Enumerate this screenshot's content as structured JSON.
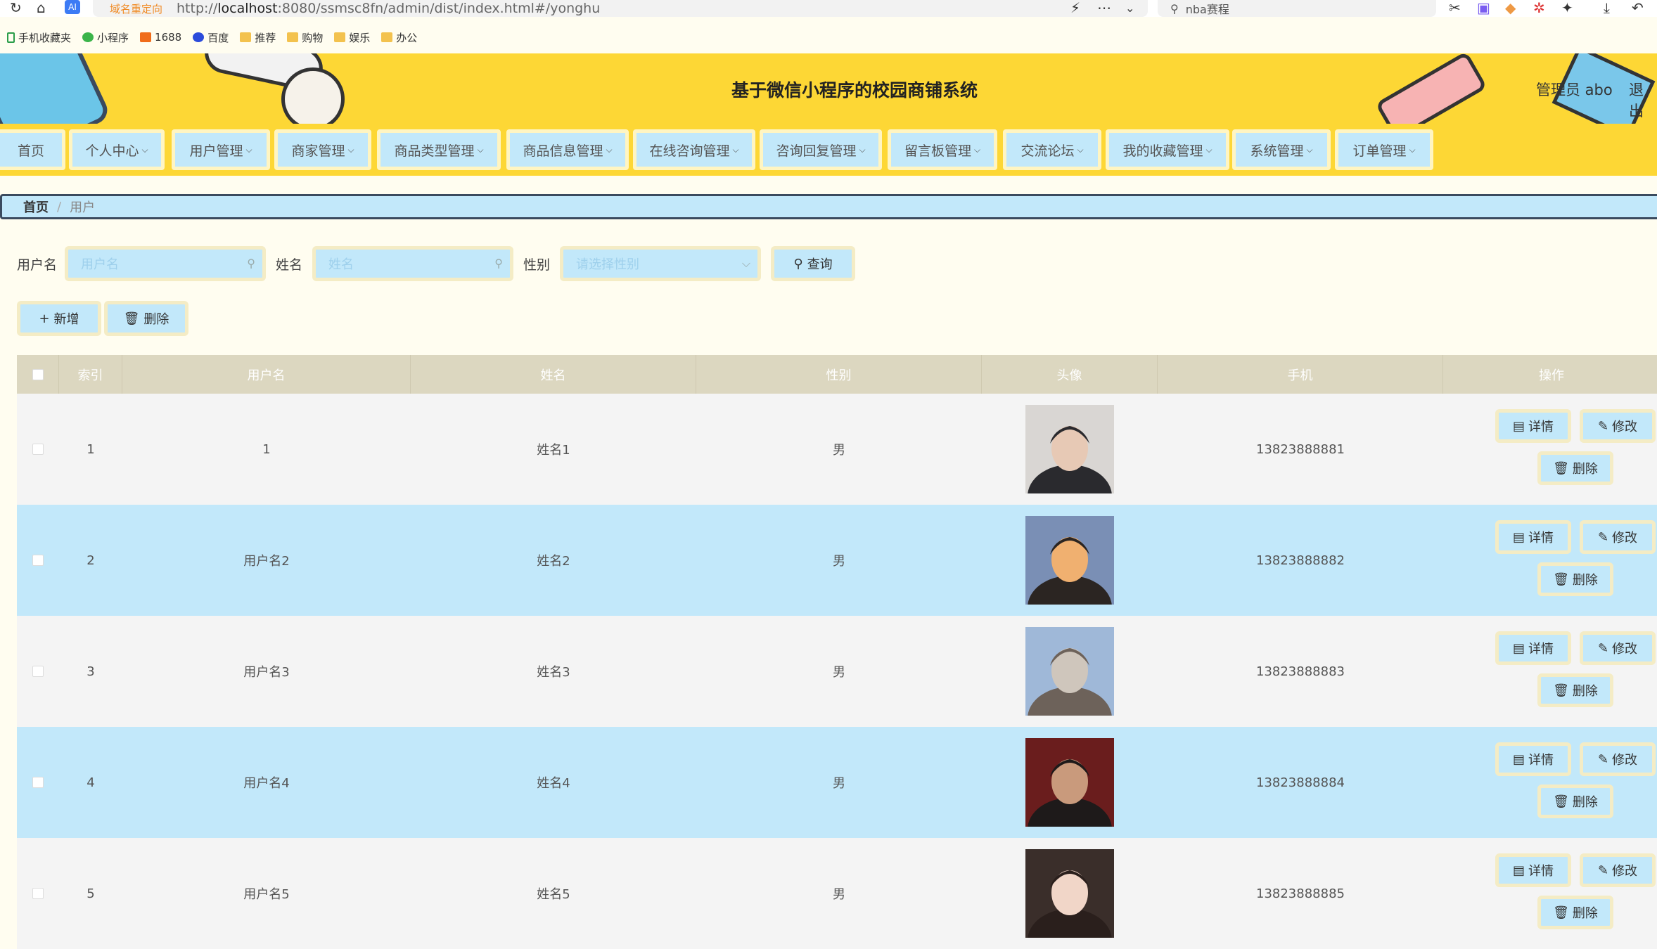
{
  "browser": {
    "redirect_label": "域名重定向",
    "url_prefix": "http://",
    "url_host": "localhost",
    "url_rest": ":8080/ssmsc8fn/admin/dist/index.html#/yonghu",
    "search_text": "nba赛程"
  },
  "bookmarks": [
    "手机收藏夹",
    "小程序",
    "1688",
    "百度",
    "推荐",
    "购物",
    "娱乐",
    "办公"
  ],
  "header": {
    "title": "基于微信小程序的校园商铺系统",
    "admin_label": "管理员 abo",
    "logout_label": "退出"
  },
  "menu": [
    "首页",
    "个人中心",
    "用户管理",
    "商家管理",
    "商品类型管理",
    "商品信息管理",
    "在线咨询管理",
    "咨询回复管理",
    "留言板管理",
    "交流论坛",
    "我的收藏管理",
    "系统管理",
    "订单管理"
  ],
  "breadcrumb": {
    "home": "首页",
    "sep": "/",
    "current": "用户"
  },
  "filters": {
    "username_label": "用户名",
    "username_placeholder": "用户名",
    "name_label": "姓名",
    "name_placeholder": "姓名",
    "gender_label": "性别",
    "gender_placeholder": "请选择性别",
    "query_label": "查询"
  },
  "actions": {
    "add_label": "新增",
    "delete_label": "删除"
  },
  "table": {
    "columns": [
      "索引",
      "用户名",
      "姓名",
      "性别",
      "头像",
      "手机",
      "操作"
    ],
    "rows": [
      {
        "index": "1",
        "username": "1",
        "name": "姓名1",
        "gender": "男",
        "phone": "13823888881"
      },
      {
        "index": "2",
        "username": "用户名2",
        "name": "姓名2",
        "gender": "男",
        "phone": "13823888882"
      },
      {
        "index": "3",
        "username": "用户名3",
        "name": "姓名3",
        "gender": "男",
        "phone": "13823888883"
      },
      {
        "index": "4",
        "username": "用户名4",
        "name": "姓名4",
        "gender": "男",
        "phone": "13823888884"
      },
      {
        "index": "5",
        "username": "用户名5",
        "name": "姓名5",
        "gender": "男",
        "phone": "13823888885"
      }
    ],
    "row_actions": {
      "detail": "详情",
      "edit": "修改",
      "delete": "删除"
    }
  },
  "colors": {
    "header_yellow": "#fdd735",
    "light_blue": "#c2e8fa",
    "cream": "#fffdf0",
    "table_head": "#dcd7c0"
  }
}
